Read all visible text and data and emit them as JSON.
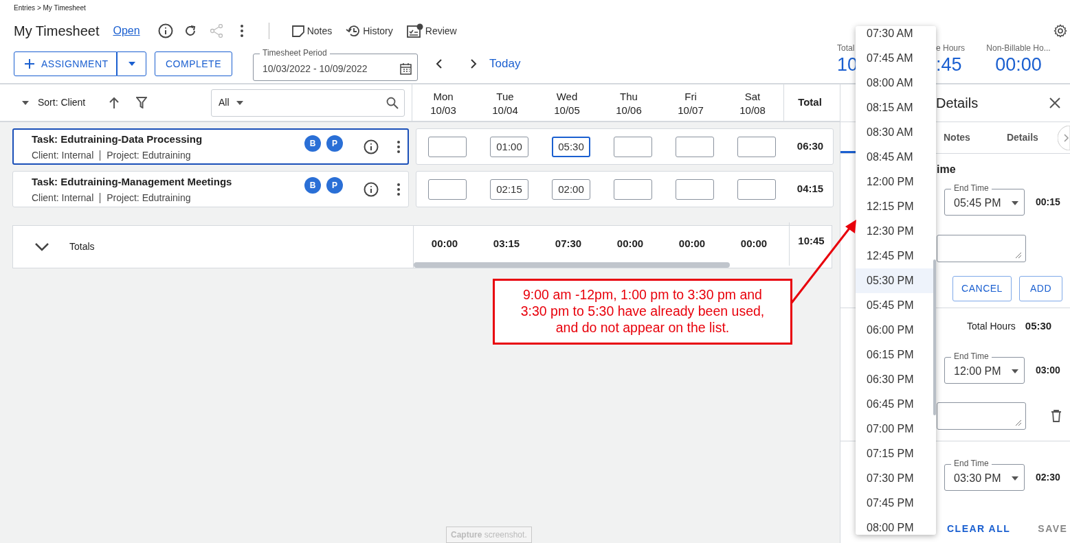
{
  "breadcrumb": "Entries > My Timesheet",
  "title": "My Timesheet",
  "status_link": "Open",
  "toolbar": [
    {
      "label": "Notes",
      "kind": "notes"
    },
    {
      "label": "History",
      "kind": "history"
    },
    {
      "label": "Review",
      "kind": "review"
    }
  ],
  "buttons": {
    "assignment": "ASSIGNMENT",
    "complete": "COMPLETE"
  },
  "period": {
    "label": "Timesheet Period",
    "value": "10/03/2022 - 10/09/2022"
  },
  "today": "Today",
  "stats": [
    {
      "label": "Total",
      "value": "10"
    },
    {
      "label": "e Hours",
      "value": ":45"
    },
    {
      "label": "Non-Billable Ho...",
      "value": "00:00"
    }
  ],
  "sort": "Sort: Client",
  "filter": {
    "value": "All"
  },
  "days": [
    {
      "day": "Mon",
      "date": "10/03"
    },
    {
      "day": "Tue",
      "date": "10/04"
    },
    {
      "day": "Wed",
      "date": "10/05"
    },
    {
      "day": "Thu",
      "date": "10/06"
    },
    {
      "day": "Fri",
      "date": "10/07"
    },
    {
      "day": "Sat",
      "date": "10/08"
    }
  ],
  "total_heading": "Total",
  "rows": [
    {
      "task": "Task: Edutraining-Data Processing",
      "client": "Client: Internal",
      "project": "Project: Edutraining",
      "badges": [
        "B",
        "P"
      ],
      "selected": true,
      "cells": [
        {
          "focused": false
        },
        {
          "value": "01:00",
          "focused": false
        },
        {
          "value": "05:30",
          "focused": true
        },
        {
          "focused": false
        },
        {
          "focused": false
        },
        {
          "focused": false
        }
      ],
      "total": "06:30"
    },
    {
      "task": "Task: Edutraining-Management Meetings",
      "client": "Client: Internal",
      "project": "Project: Edutraining",
      "badges": [
        "B",
        "P"
      ],
      "selected": false,
      "cells": [
        {
          "focused": false
        },
        {
          "value": "02:15",
          "focused": false
        },
        {
          "value": "02:00",
          "focused": false
        },
        {
          "focused": false
        },
        {
          "focused": false
        },
        {
          "focused": false
        }
      ],
      "total": "04:15"
    }
  ],
  "totals": {
    "label": "Totals",
    "days": [
      "00:00",
      "03:15",
      "07:30",
      "00:00",
      "00:00",
      "00:00"
    ],
    "total": "10:45"
  },
  "panel": {
    "title": "Details",
    "tabs": [
      "Notes",
      "Details"
    ],
    "section_title": "ime",
    "entries": [
      {
        "end_label": "End Time",
        "end": "05:45 PM",
        "duration": "00:15",
        "kind": "editing",
        "cancel": "CANCEL",
        "add": "ADD"
      },
      {
        "end_label": "End Time",
        "end": "12:00 PM",
        "duration": "03:00",
        "kind": "saved",
        "total_label": "Total Hours",
        "total": "05:30"
      },
      {
        "end_label": "End Time",
        "end": "03:30 PM",
        "duration": "02:30",
        "kind": "plain"
      }
    ],
    "clear": "CLEAR ALL",
    "save": {
      "label": "SAVE",
      "disabled": true
    }
  },
  "dropdown": [
    {
      "label": "07:30 AM",
      "selected": false
    },
    {
      "label": "07:45 AM",
      "selected": false
    },
    {
      "label": "08:00 AM",
      "selected": false
    },
    {
      "label": "08:15 AM",
      "selected": false
    },
    {
      "label": "08:30 AM",
      "selected": false
    },
    {
      "label": "08:45 AM",
      "selected": false
    },
    {
      "label": "12:00 PM",
      "selected": false
    },
    {
      "label": "12:15 PM",
      "selected": false
    },
    {
      "label": "12:30 PM",
      "selected": false
    },
    {
      "label": "12:45 PM",
      "selected": false
    },
    {
      "label": "05:30 PM",
      "selected": true
    },
    {
      "label": "05:45 PM",
      "selected": false
    },
    {
      "label": "06:00 PM",
      "selected": false
    },
    {
      "label": "06:15 PM",
      "selected": false
    },
    {
      "label": "06:30 PM",
      "selected": false
    },
    {
      "label": "06:45 PM",
      "selected": false
    },
    {
      "label": "07:00 PM",
      "selected": false
    },
    {
      "label": "07:15 PM",
      "selected": false
    },
    {
      "label": "07:30 PM",
      "selected": false
    },
    {
      "label": "07:45 PM",
      "selected": false
    },
    {
      "label": "08:00 PM",
      "selected": false
    }
  ],
  "annotation": "9:00 am -12pm, 1:00 pm to 3:30 pm and 3:30 pm to 5:30 have already been used, and do not appear on the list.",
  "tooltip": "**Capture** screenshot."
}
